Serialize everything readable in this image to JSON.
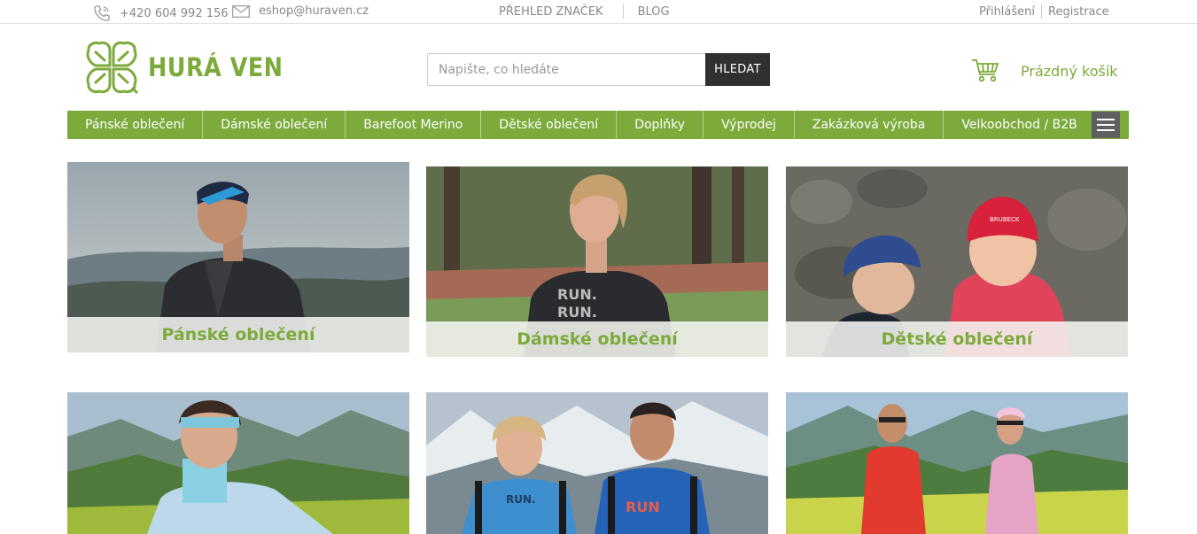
{
  "topbar": {
    "phone": "+420 604 992 156",
    "email": "eshop@huraven.cz",
    "brands_link": "PŘEHLED ZNAČEK",
    "blog_link": "BLOG",
    "login": "Přihlášení",
    "register": "Registrace"
  },
  "logo": {
    "text": "HURÁ VEN"
  },
  "search": {
    "placeholder": "Napište, co hledáte",
    "button": "HLEDAT"
  },
  "cart": {
    "label": "Prázdný košík"
  },
  "nav": {
    "items": [
      "Pánské oblečení",
      "Dámské oblečení",
      "Barefoot Merino",
      "Dětské oblečení",
      "Doplňky",
      "Výprodej",
      "Zakázková výroba",
      "Velkoobchod / B2B"
    ]
  },
  "categories": [
    {
      "label": "Pánské oblečení"
    },
    {
      "label": "Dámské oblečení"
    },
    {
      "label": "Dětské oblečení"
    },
    {
      "label": ""
    },
    {
      "label": ""
    },
    {
      "label": ""
    }
  ],
  "colors": {
    "brand_green": "#7cab3b",
    "search_button": "#2f3032",
    "menu_button": "#5d5f61"
  }
}
